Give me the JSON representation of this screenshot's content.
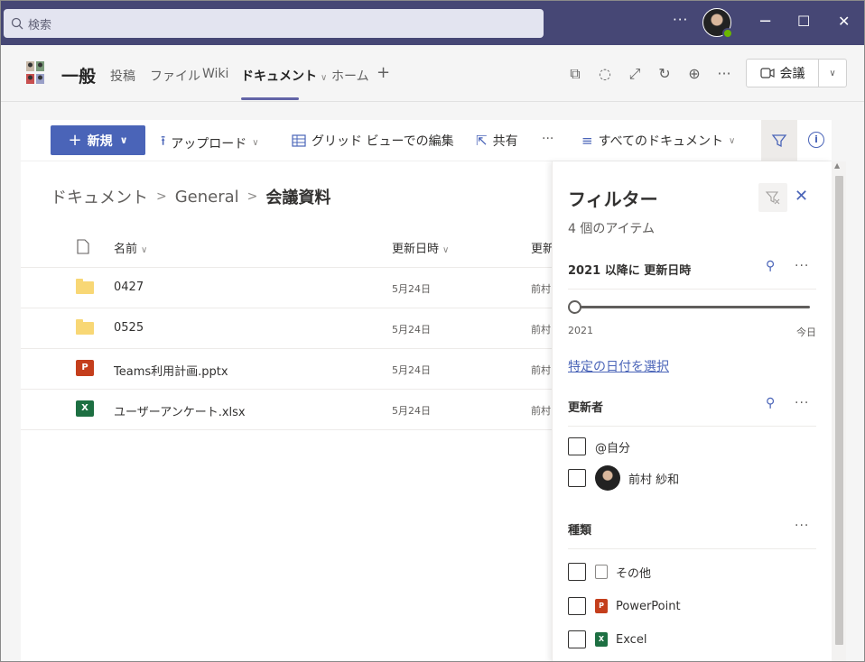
{
  "titlebar": {
    "search_placeholder": "検索",
    "more": "···",
    "minimize": "−",
    "maximize": "☐",
    "close": "✕"
  },
  "channel": {
    "name": "一般",
    "tabs": [
      {
        "label": "投稿"
      },
      {
        "label": "ファイル"
      },
      {
        "label": "Wiki"
      },
      {
        "label": "ドキュメント",
        "active": true
      },
      {
        "label": "ホーム"
      }
    ],
    "add_tab": "+",
    "actions_more": "···",
    "meeting_label": "会議"
  },
  "commandbar": {
    "new_label": "新規",
    "upload_label": "アップロード",
    "grid_edit_label": "グリッド ビューでの編集",
    "share_label": "共有",
    "more": "···",
    "view_label": "すべてのドキュメント"
  },
  "breadcrumb": {
    "items": [
      "ドキュメント",
      "General"
    ],
    "current": "会議資料",
    "separator": ">"
  },
  "list": {
    "columns": {
      "name": "名前",
      "modified": "更新日時",
      "modified_by": "更新"
    },
    "rows": [
      {
        "name": "0427",
        "type": "folder",
        "modified": "5月24日",
        "by": "前村"
      },
      {
        "name": "0525",
        "type": "folder",
        "modified": "5月24日",
        "by": "前村"
      },
      {
        "name": "Teams利用計画.pptx",
        "type": "pptx",
        "modified": "5月24日",
        "by": "前村"
      },
      {
        "name": "ユーザーアンケート.xlsx",
        "type": "xlsx",
        "modified": "5月24日",
        "by": "前村"
      }
    ]
  },
  "filter": {
    "title": "フィルター",
    "count": "4 個のアイテム",
    "date_section": {
      "header": "2021 以降に 更新日時",
      "slider_min": "2021",
      "slider_max": "今日",
      "slider_value": 0,
      "link": "特定の日付を選択"
    },
    "author_section": {
      "header": "更新者",
      "options": [
        "@自分",
        "前村 紗和"
      ]
    },
    "type_section": {
      "header": "種類",
      "options": [
        "その他",
        "PowerPoint",
        "Excel"
      ]
    },
    "more": "···"
  },
  "colors": {
    "titlebar": "#464775",
    "accent": "#4a64b8",
    "tab_underline": "#6264a7"
  }
}
